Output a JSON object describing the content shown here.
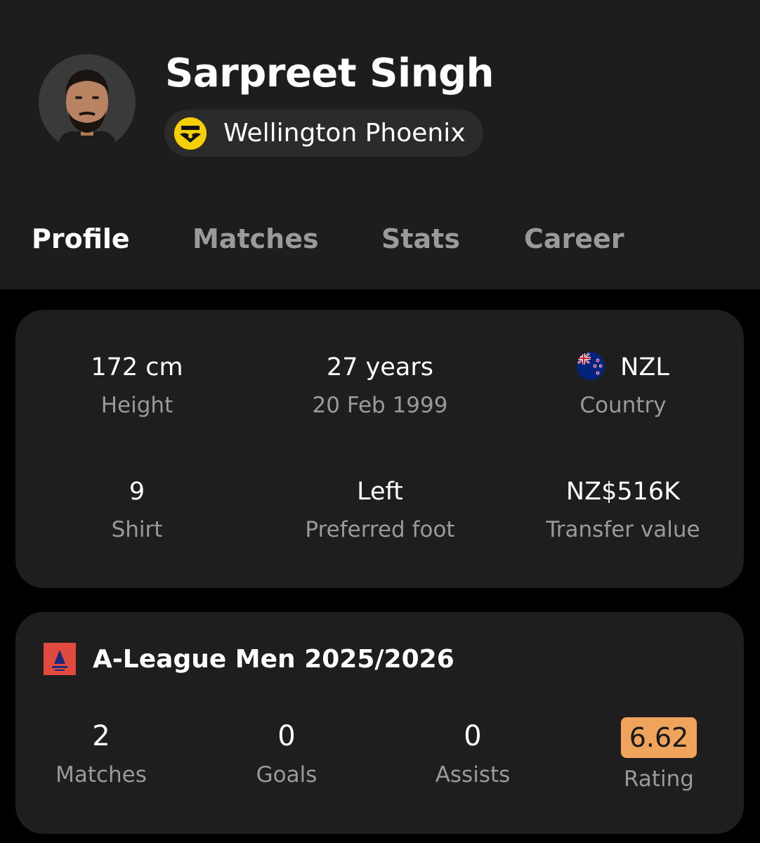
{
  "player": {
    "name": "Sarpreet Singh",
    "team": "Wellington Phoenix"
  },
  "tabs": [
    "Profile",
    "Matches",
    "Stats",
    "Career"
  ],
  "active_tab": "Profile",
  "info": [
    {
      "value": "172 cm",
      "label": "Height"
    },
    {
      "value": "27 years",
      "label": "20 Feb 1999"
    },
    {
      "value": "NZL",
      "label": "Country"
    },
    {
      "value": "9",
      "label": "Shirt"
    },
    {
      "value": "Left",
      "label": "Preferred foot"
    },
    {
      "value": "NZ$516K",
      "label": "Transfer value"
    }
  ],
  "league": {
    "title": "A-League Men 2025/2026",
    "stats": [
      {
        "value": "2",
        "label": "Matches"
      },
      {
        "value": "0",
        "label": "Goals"
      },
      {
        "value": "0",
        "label": "Assists"
      },
      {
        "value": "6.62",
        "label": "Rating"
      }
    ]
  },
  "colors": {
    "header_bg": "#1d1d1d",
    "card_bg": "#1e1e1e",
    "muted_text": "#9a9a9a",
    "rating_bg": "#f0a35a",
    "team_badge": "#f5d000",
    "league_logo": "#e04a3f"
  },
  "icons": {
    "avatar": "player-photo",
    "team_badge": "wellington-phoenix-crest",
    "flag": "new-zealand-flag",
    "league_logo": "a-league-logo"
  }
}
